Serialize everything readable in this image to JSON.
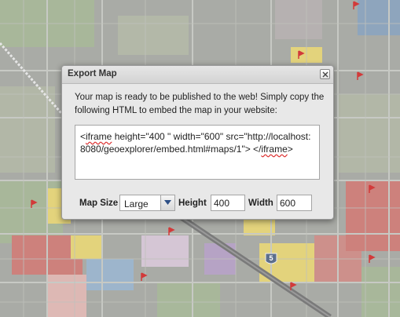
{
  "dialog": {
    "title": "Export Map",
    "message": "Your map is ready to be published to the web! Simply copy the following HTML to embed the map in your website:",
    "embed": {
      "prefix": "<",
      "tag_open": "iframe",
      "middle": " height=\"400 \" width=\"600\" src=\"http://localhost:8080/geoexplorer/embed.html#maps/1\"> </",
      "tag_close": "iframe",
      "suffix": ">"
    },
    "map_size_label": "Map Size",
    "map_size_value": "Large",
    "height_label": "Height",
    "height_value": "400",
    "width_label": "Width",
    "width_value": "600"
  },
  "map": {
    "highway_label": "5",
    "colors": {
      "background": "#a9aba6",
      "road": "#c7c9c4",
      "highway": "#7a7a7a",
      "zone_yellow": "#e7d67a",
      "zone_red": "#cf7f7a",
      "zone_blue": "#9db6cf",
      "zone_green": "#a8b89a"
    }
  }
}
